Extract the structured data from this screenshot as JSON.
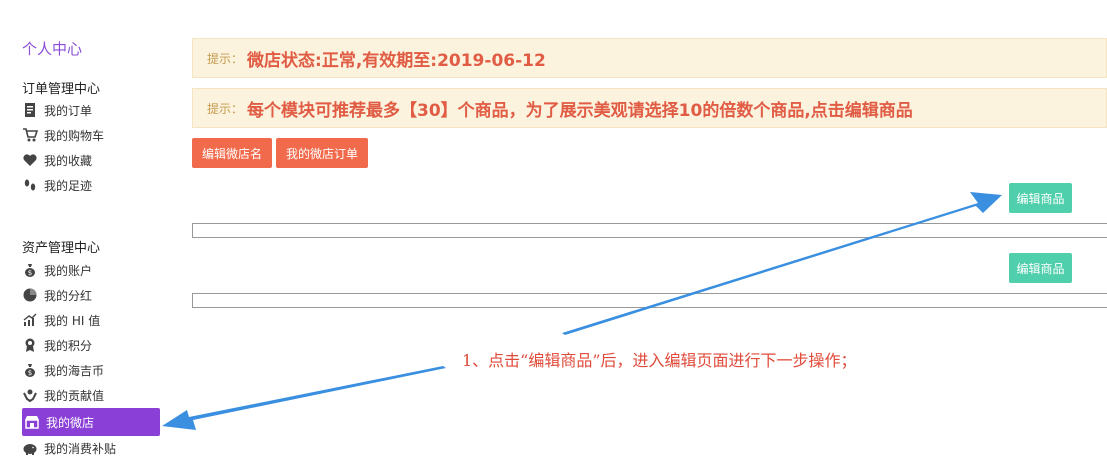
{
  "sidebar": {
    "title": "个人中心",
    "groups": [
      {
        "title": "订单管理中心",
        "items": [
          {
            "label": "我的订单",
            "icon": "document-icon"
          },
          {
            "label": "我的购物车",
            "icon": "cart-icon"
          },
          {
            "label": "我的收藏",
            "icon": "heart-icon"
          },
          {
            "label": "我的足迹",
            "icon": "footprint-icon"
          }
        ]
      },
      {
        "title": "资产管理中心",
        "items": [
          {
            "label": "我的账户",
            "icon": "money-bag-icon"
          },
          {
            "label": "我的分红",
            "icon": "pie-chart-icon"
          },
          {
            "label": "我的 HI 值",
            "icon": "trend-chart-icon"
          },
          {
            "label": "我的积分",
            "icon": "award-icon"
          },
          {
            "label": "我的海吉币",
            "icon": "coin-bag-icon"
          },
          {
            "label": "我的贡献值",
            "icon": "hands-icon"
          },
          {
            "label": "我的微店",
            "icon": "store-icon",
            "active": true
          },
          {
            "label": "我的消费补贴",
            "icon": "piggy-bank-icon"
          }
        ]
      }
    ]
  },
  "tips": [
    {
      "label": "提示：",
      "text": "微店状态:正常,有效期至:2019-06-12"
    },
    {
      "label": "提示：",
      "text": "每个模块可推荐最多【30】个商品，为了展示美观请选择10的倍数个商品,点击编辑商品"
    }
  ],
  "actions": {
    "edit_shop_name": "编辑微店名",
    "my_shop_orders": "我的微店订单"
  },
  "modules": [
    {
      "edit_label": "编辑商品"
    },
    {
      "edit_label": "编辑商品"
    }
  ],
  "annotation": "1、点击“编辑商品”后，进入编辑页面进行下一步操作；",
  "colors": {
    "accent_purple": "#8a3fd7",
    "button_red": "#f26a4c",
    "button_green": "#4fcfab",
    "tip_bg": "#fcf3df",
    "tip_text": "#e05c44",
    "arrow_blue": "#3a8fe0"
  }
}
